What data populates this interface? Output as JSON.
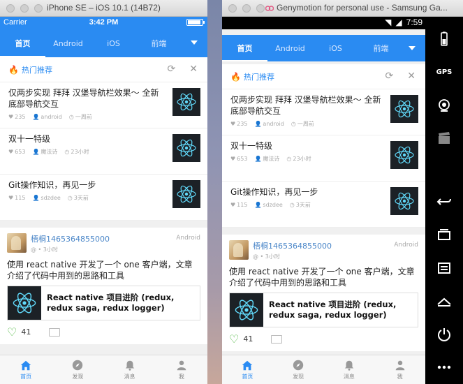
{
  "ios": {
    "window_title": "iPhone SE – iOS 10.1 (14B72)",
    "status": {
      "carrier": "Carrier",
      "time": "3:42 PM"
    }
  },
  "android": {
    "window_title": "Genymotion for personal use - Samsung Ga...",
    "status": {
      "time": "7:59"
    },
    "side": {
      "gps_label": "GPS"
    }
  },
  "tabs": [
    "首页",
    "Android",
    "iOS",
    "前端"
  ],
  "hot": {
    "title": "热门推荐",
    "articles": [
      {
        "title": "仅两步实现 拜拜 汉堡导航栏效果～ 全新底部导航交互",
        "likes": "235",
        "author": "android",
        "time": "一周前"
      },
      {
        "title": "双十一特级",
        "likes": "653",
        "author": "魔法诗",
        "time": "23小时"
      },
      {
        "title": "Git操作知识，再见一步",
        "likes": "115",
        "author": "sdzdee",
        "time": "3天前"
      }
    ]
  },
  "feed": {
    "user": "梧桐1465364855000",
    "sub": "@ • 3小时",
    "platform": "Android",
    "text": "使用 react native 开发了一个 one 客户端，文章介绍了代码中用到的思路和工具",
    "link_title": "React native 项目进阶 (redux, redux saga, redux logger)",
    "likes": "41"
  },
  "nav": [
    "首页",
    "发现",
    "消息",
    "我"
  ],
  "colors": {
    "accent": "#2a8bf2",
    "like": "#4fb840"
  }
}
